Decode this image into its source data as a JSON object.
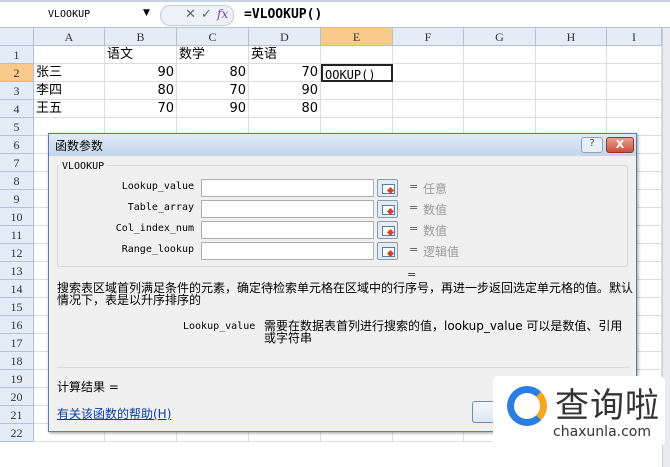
{
  "formula_bar": {
    "name_box": "VLOOKUP",
    "dropdown_icon": "▼",
    "cancel_icon": "✕",
    "enter_icon": "✓",
    "fx_label": "fx",
    "formula": "=VLOOKUP()"
  },
  "columns": [
    "A",
    "B",
    "C",
    "D",
    "E",
    "F",
    "G",
    "H",
    "I"
  ],
  "selected_column": "E",
  "selected_row": "2",
  "rows": [
    {
      "num": "1",
      "cells": [
        "",
        "语文",
        "数学",
        "英语",
        "",
        "",
        "",
        "",
        ""
      ]
    },
    {
      "num": "2",
      "cells": [
        "张三",
        "90",
        "80",
        "70",
        "OOKUP()",
        "",
        "",
        "",
        ""
      ]
    },
    {
      "num": "3",
      "cells": [
        "李四",
        "80",
        "70",
        "90",
        "",
        "",
        "",
        "",
        ""
      ]
    },
    {
      "num": "4",
      "cells": [
        "王五",
        "70",
        "90",
        "80",
        "",
        "",
        "",
        "",
        ""
      ]
    },
    {
      "num": "5",
      "cells": []
    },
    {
      "num": "6",
      "cells": []
    },
    {
      "num": "7",
      "cells": []
    },
    {
      "num": "8",
      "cells": []
    },
    {
      "num": "9",
      "cells": []
    },
    {
      "num": "10",
      "cells": []
    },
    {
      "num": "11",
      "cells": []
    },
    {
      "num": "12",
      "cells": []
    },
    {
      "num": "13",
      "cells": []
    },
    {
      "num": "14",
      "cells": []
    },
    {
      "num": "15",
      "cells": []
    },
    {
      "num": "16",
      "cells": []
    },
    {
      "num": "17",
      "cells": []
    },
    {
      "num": "18",
      "cells": []
    },
    {
      "num": "19",
      "cells": []
    },
    {
      "num": "20",
      "cells": []
    },
    {
      "num": "21",
      "cells": []
    },
    {
      "num": "22",
      "cells": []
    }
  ],
  "dialog": {
    "title": "函数参数",
    "help_label": "?",
    "close_label": "X",
    "function_name": "VLOOKUP",
    "args": [
      {
        "label": "Lookup_value",
        "value": "",
        "result": "任意"
      },
      {
        "label": "Table_array",
        "value": "",
        "result": "数值"
      },
      {
        "label": "Col_index_num",
        "value": "",
        "result": "数值"
      },
      {
        "label": "Range_lookup",
        "value": "",
        "result": "逻辑值"
      }
    ],
    "eq": "=",
    "result_eq": "=",
    "description": "搜索表区域首列满足条件的元素，确定待检索单元格在区域中的行序号，再进一步返回选定单元格的值。默认情况下，表是以升序排序的",
    "arg_name": "Lookup_value",
    "arg_description": "需要在数据表首列进行搜索的值，lookup_value 可以是数值、引用或字符串",
    "result_label": "计算结果 =",
    "help_link": "有关该函数的帮助(H)"
  },
  "watermark": {
    "text": "查询啦",
    "url": "chaxunla.com"
  }
}
